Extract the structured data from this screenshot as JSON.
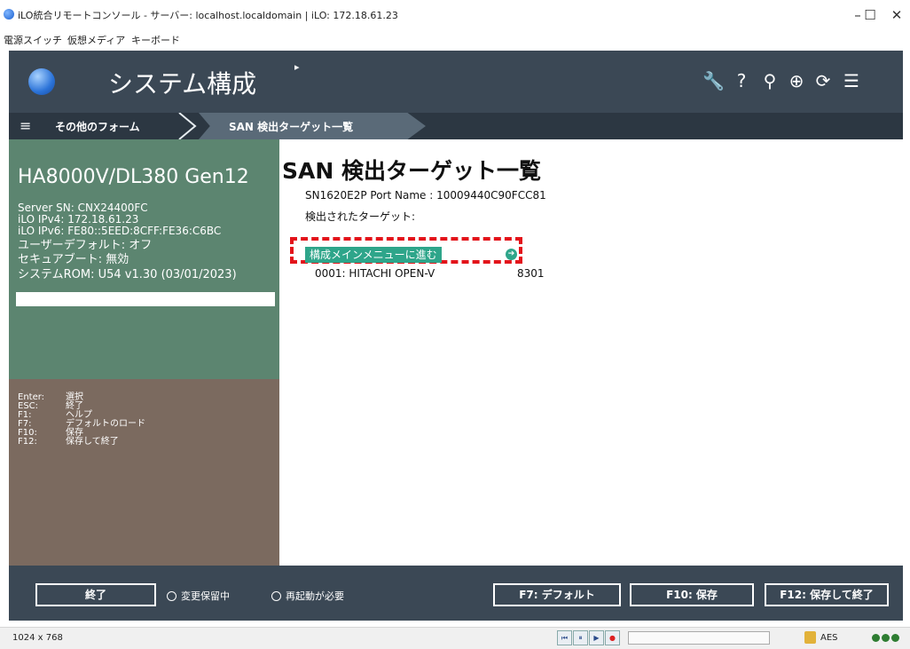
{
  "window": {
    "title": "iLO統合リモートコンソール - サーバー: localhost.localdomain | iLO: 172.18.61.23",
    "controls": {
      "minimize": "–",
      "maximize": "☐",
      "close": "✕"
    }
  },
  "console_menu": [
    "電源スイッチ",
    "仮想メディア",
    "キーボード"
  ],
  "header": {
    "title": "システム構成",
    "icons": [
      "wrench-icon",
      "help-icon",
      "search-icon",
      "globe-icon",
      "refresh-icon",
      "server-icon"
    ],
    "icon_glyphs": [
      "🔧",
      "?",
      "⚲",
      "⊕",
      "⟳",
      "☰"
    ]
  },
  "breadcrumb": {
    "menu_glyph": "≡",
    "items": [
      "その他のフォーム",
      "SAN 検出ターゲット一覧"
    ]
  },
  "server": {
    "name": "HA8000V/DL380 Gen12",
    "sn": "Server SN: CNX24400FC",
    "ipv4": "iLO IPv4: 172.18.61.23",
    "ipv6": "iLO IPv6: FE80::5EED:8CFF:FE36:C6BC",
    "user_default": "ユーザーデフォルト: オフ",
    "secure_boot": "セキュアブート: 無効",
    "system_rom": "システムROM: U54 v1.30 (03/01/2023)"
  },
  "keys": [
    {
      "key": "Enter:",
      "action": "選択"
    },
    {
      "key": "ESC:",
      "action": "終了"
    },
    {
      "key": "F1:",
      "action": "ヘルプ"
    },
    {
      "key": "F7:",
      "action": "デフォルトのロード"
    },
    {
      "key": "F10:",
      "action": "保存"
    },
    {
      "key": "F12:",
      "action": "保存して終了"
    }
  ],
  "main": {
    "title": "SAN 検出ターゲット一覧",
    "port_line": "SN1620E2P Port Name : 10009440C90FCC81",
    "detected_label": "検出されたターゲット:",
    "goto_label": "構成メインメニューに進む",
    "goto_arrow": "➔",
    "target": {
      "name": "0001: HITACHI OPEN-V",
      "port": "8301"
    }
  },
  "bottom": {
    "exit": "終了",
    "pending": "変更保留中",
    "reboot": "再起動が必要",
    "f7": "F7: デフォルト",
    "f10": "F10: 保存",
    "f12": "F12: 保存して終了"
  },
  "status": {
    "resolution": "1024 x 768",
    "media": [
      "⏮",
      "⏸",
      "▶",
      "●"
    ],
    "encryption": "AES",
    "lights": [
      "#2e7d32",
      "#2e7d32",
      "#2e7d32"
    ]
  }
}
